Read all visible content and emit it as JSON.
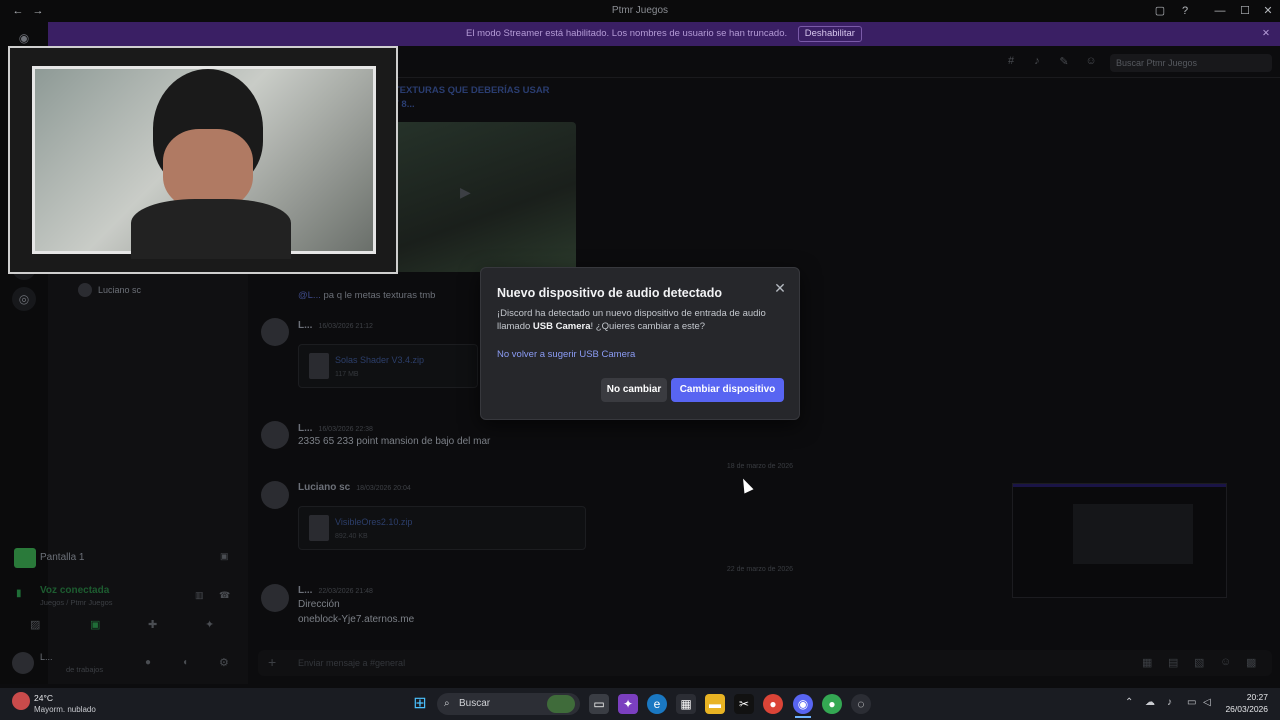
{
  "window": {
    "title": "Ptmr Juegos",
    "controls": [
      "—",
      "☐",
      "✕"
    ]
  },
  "banner": {
    "text": "El modo Streamer está habilitado. Los nombres de usuario se han truncado.",
    "button": "Deshabilitar"
  },
  "channel_header": {
    "search_placeholder": "Buscar Ptmr Juegos"
  },
  "sidebar": {
    "voice_member": "Luciano sc",
    "stream_name": "Pantalla 1",
    "voice_status": "Voz conectada",
    "voice_channel": "Juegos / Ptmr Juegos",
    "user_name": "L...",
    "user_status": "de trabajos"
  },
  "messages": {
    "top_title": "DE TEXTURAS QUE DEBERÍAS USAR\nVA Y 8...",
    "reply_preview": "pa q le metas texturas tmb",
    "m1_user": "L...",
    "m1_time": "16/03/2026 21:12",
    "m1_file": "Solas Shader V3.4.zip",
    "m1_size": "117 MB",
    "m2_user": "L...",
    "m2_time": "16/03/2026 22:38",
    "m2_text": "2335 65 233 point mansion de bajo del mar",
    "divider1": "18 de marzo de 2026",
    "m3_user": "Luciano sc",
    "m3_time": "18/03/2026 20:04",
    "m3_file": "VisibleOres2.10.zip",
    "m3_size": "892.40 KB",
    "divider2": "22 de marzo de 2026",
    "m4_user": "L...",
    "m4_time": "22/03/2026 21:48",
    "m4_line1": "Dirección",
    "m4_line2": "oneblock-Yje7.aternos.me",
    "composer_placeholder": "Enviar mensaje a #general"
  },
  "modal": {
    "title": "Nuevo dispositivo de audio detectado",
    "body_pre": "¡Discord ha detectado un nuevo dispositivo de entrada de audio llamado ",
    "device": "USB Camera",
    "body_post": "! ¿Quieres cambiar a este?",
    "link": "No volver a sugerir USB Camera",
    "btn_keep": "No cambiar",
    "btn_change": "Cambiar dispositivo",
    "accent": "#5865f2"
  },
  "taskbar": {
    "weather_temp": "24°C",
    "weather_desc": "Mayorm. nublado",
    "search": "Buscar",
    "time": "20:27",
    "date": "26/03/2026"
  }
}
